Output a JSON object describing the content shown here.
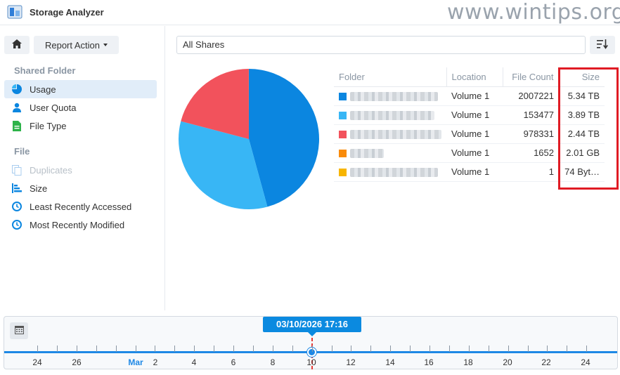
{
  "app": {
    "title": "Storage Analyzer",
    "watermark": "www.wintips.org"
  },
  "toolbar": {
    "report_action_label": "Report Action"
  },
  "sidebar": {
    "sections": [
      {
        "heading": "Shared Folder"
      },
      {
        "heading": "File"
      }
    ],
    "items": [
      {
        "label": "Usage",
        "icon": "pie-icon",
        "active": true
      },
      {
        "label": "User Quota",
        "icon": "user-icon"
      },
      {
        "label": "File Type",
        "icon": "file-icon"
      },
      {
        "label": "Duplicates",
        "icon": "duplicates-icon",
        "disabled": true
      },
      {
        "label": "Size",
        "icon": "size-bars-icon"
      },
      {
        "label": "Least Recently Accessed",
        "icon": "clock-icon"
      },
      {
        "label": "Most Recently Modified",
        "icon": "clock-icon"
      }
    ]
  },
  "filter": {
    "selected": "All Shares"
  },
  "table": {
    "columns": [
      "Folder",
      "Location",
      "File Count",
      "Size"
    ],
    "rows": [
      {
        "color": "#0b86e0",
        "location": "Volume 1",
        "file_count": "2007221",
        "size": "5.34 TB"
      },
      {
        "color": "#38b6f5",
        "location": "Volume 1",
        "file_count": "153477",
        "size": "3.89 TB"
      },
      {
        "color": "#f2525c",
        "location": "Volume 1",
        "file_count": "978331",
        "size": "2.44 TB"
      },
      {
        "color": "#f98b0a",
        "location": "Volume 1",
        "file_count": "1652",
        "size": "2.01 GB"
      },
      {
        "color": "#f7b500",
        "location": "Volume 1",
        "file_count": "1",
        "size": "74 Byt…"
      }
    ]
  },
  "pie": {
    "slices": [
      {
        "value": 5.34,
        "color": "#0b86e0"
      },
      {
        "value": 3.89,
        "color": "#38b6f5"
      },
      {
        "value": 2.44,
        "color": "#f2525c"
      },
      {
        "value": 0.00201,
        "color": "#f98b0a"
      },
      {
        "value": 1e-10,
        "color": "#f7b500"
      }
    ]
  },
  "timeline": {
    "selected_datetime": "03/10/2026 17:16",
    "labels": [
      {
        "text": "24",
        "month": false
      },
      {
        "text": "26",
        "month": false
      },
      {
        "text": "Mar",
        "month": true
      },
      {
        "text": "2",
        "month": false
      },
      {
        "text": "4",
        "month": false
      },
      {
        "text": "6",
        "month": false
      },
      {
        "text": "8",
        "month": false
      },
      {
        "text": "10",
        "month": false
      },
      {
        "text": "12",
        "month": false
      },
      {
        "text": "14",
        "month": false
      },
      {
        "text": "16",
        "month": false
      },
      {
        "text": "18",
        "month": false
      },
      {
        "text": "20",
        "month": false
      },
      {
        "text": "22",
        "month": false
      },
      {
        "text": "24",
        "month": false
      }
    ]
  }
}
